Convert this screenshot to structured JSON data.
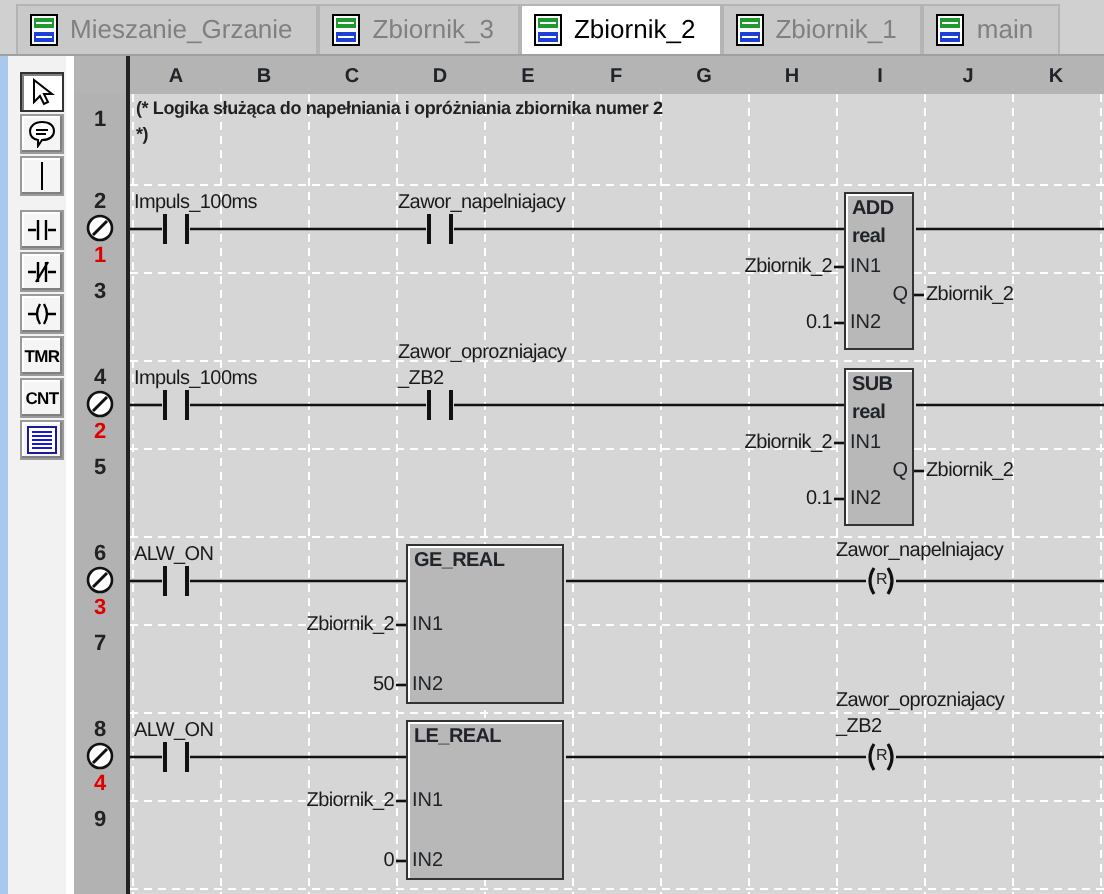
{
  "tabs": [
    {
      "label": "Mieszanie_Grzanie",
      "selected": false
    },
    {
      "label": "Zbiornik_3",
      "selected": false
    },
    {
      "label": "Zbiornik_2",
      "selected": true
    },
    {
      "label": "Zbiornik_1",
      "selected": false
    },
    {
      "label": "main",
      "selected": false
    }
  ],
  "tool_groups": [
    [
      {
        "kind": "pointer",
        "selected": true
      },
      {
        "kind": "comment",
        "selected": false
      },
      {
        "kind": "line",
        "selected": false
      }
    ],
    [
      {
        "kind": "contact",
        "selected": false
      },
      {
        "kind": "contact_nc",
        "selected": false
      },
      {
        "kind": "coil",
        "selected": false
      },
      {
        "kind": "text",
        "label": "TMR",
        "selected": false
      },
      {
        "kind": "text",
        "label": "CNT",
        "selected": false
      },
      {
        "kind": "table",
        "selected": false
      }
    ]
  ],
  "columns": [
    "A",
    "B",
    "C",
    "D",
    "E",
    "F",
    "G",
    "H",
    "I",
    "J",
    "K"
  ],
  "rows": [
    {
      "number": "1"
    },
    {
      "number": "2",
      "rung": "1"
    },
    {
      "number": "3"
    },
    {
      "number": "4",
      "rung": "2"
    },
    {
      "number": "5"
    },
    {
      "number": "6",
      "rung": "3"
    },
    {
      "number": "7"
    },
    {
      "number": "8",
      "rung": "4"
    },
    {
      "number": "9"
    }
  ],
  "comment": [
    "(* Logika służąca do napełniania i opróżniania zbiornika numer 2",
    "*)"
  ],
  "rungs": [
    {
      "kind": "math",
      "contacts": [
        {
          "lines": [
            "Impuls_100ms"
          ]
        },
        {
          "lines": [
            "Zawor_napelniajacy"
          ]
        }
      ],
      "block": {
        "name": "ADD",
        "type": "real",
        "inputs": [
          {
            "pin": "IN1",
            "value": "Zbiornik_2"
          },
          {
            "pin": "IN2",
            "value": "0.1"
          }
        ],
        "output": {
          "pin": "Q",
          "value": "Zbiornik_2"
        }
      }
    },
    {
      "kind": "math",
      "contacts": [
        {
          "lines": [
            "Impuls_100ms"
          ]
        },
        {
          "lines": [
            "Zawor_oprozniajacy",
            "_ZB2"
          ]
        }
      ],
      "block": {
        "name": "SUB",
        "type": "real",
        "inputs": [
          {
            "pin": "IN1",
            "value": "Zbiornik_2"
          },
          {
            "pin": "IN2",
            "value": "0.1"
          }
        ],
        "output": {
          "pin": "Q",
          "value": "Zbiornik_2"
        }
      }
    },
    {
      "kind": "compare",
      "contacts": [
        {
          "lines": [
            "ALW_ON"
          ]
        }
      ],
      "block": {
        "name": "GE_REAL",
        "inputs": [
          {
            "pin": "IN1",
            "value": "Zbiornik_2"
          },
          {
            "pin": "IN2",
            "value": "50"
          }
        ]
      },
      "coil": {
        "lines": [
          "Zawor_napelniajacy"
        ],
        "letter": "R"
      }
    },
    {
      "kind": "compare",
      "contacts": [
        {
          "lines": [
            "ALW_ON"
          ]
        }
      ],
      "block": {
        "name": "LE_REAL",
        "inputs": [
          {
            "pin": "IN1",
            "value": "Zbiornik_2"
          },
          {
            "pin": "IN2",
            "value": "0"
          }
        ]
      },
      "coil": {
        "lines": [
          "Zawor_oprozniajacy",
          "_ZB2"
        ],
        "letter": "R"
      }
    }
  ]
}
